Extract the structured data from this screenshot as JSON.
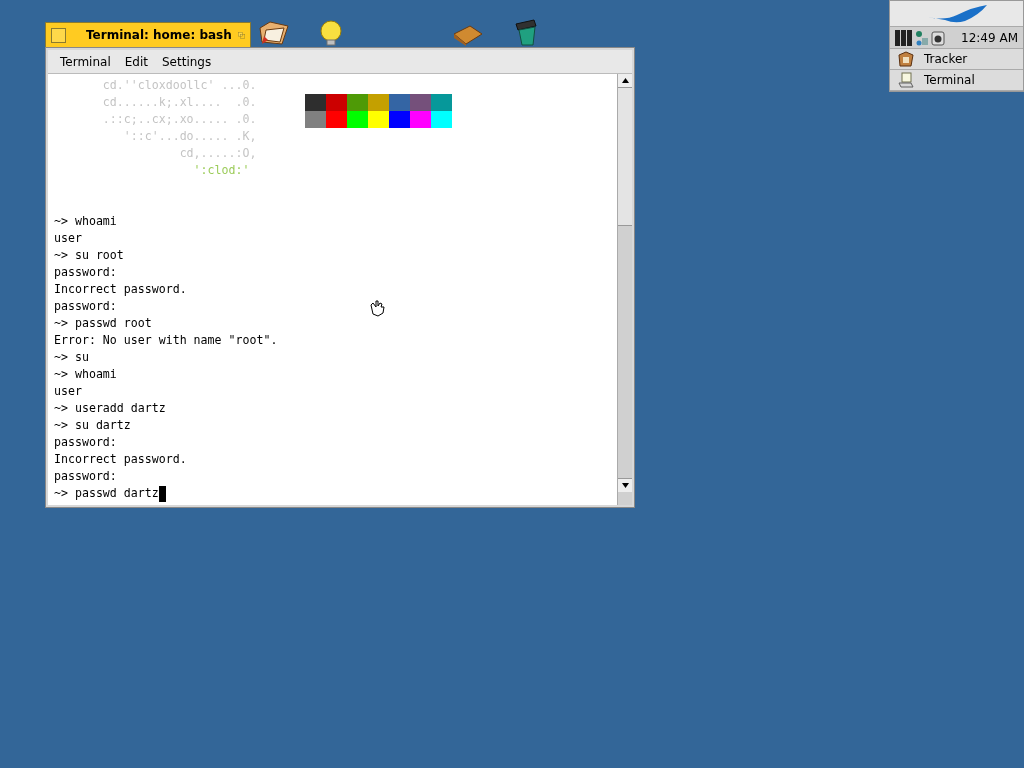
{
  "window": {
    "title": "Terminal: home: bash",
    "focused": true,
    "menu": [
      "Terminal",
      "Edit",
      "Settings"
    ]
  },
  "terminal": {
    "logo_lines": [
      {
        "text": "       cd.''cloxdoollc' ...0.",
        "color": "#c4c4c4"
      },
      {
        "text": "       cd......k;.xl....  .0.",
        "color": "#c4c4c4"
      },
      {
        "text": "       .::c;..cx;.xo..... .0.",
        "color": "#c4c4c4"
      },
      {
        "text": "          '::c'...do..... .K,",
        "color": "#c4c4c4"
      },
      {
        "text": "                  cd,.....:O,",
        "color": "#c4c4c4"
      },
      {
        "text": "                    ':clod:'",
        "color": "#9ccc5a"
      }
    ],
    "palette": [
      {
        "color": "#2e2e2e"
      },
      {
        "color": "#cc0000"
      },
      {
        "color": "#4e9a06"
      },
      {
        "color": "#c4a000"
      },
      {
        "color": "#3465a4"
      },
      {
        "color": "#75507b"
      },
      {
        "color": "#06989a"
      },
      {
        "color": "#808080"
      },
      {
        "color": "#ff0000"
      },
      {
        "color": "#00ff00"
      },
      {
        "color": "#ffff00"
      },
      {
        "color": "#0000ff"
      },
      {
        "color": "#ff00ff"
      },
      {
        "color": "#00ffff"
      }
    ],
    "lines": [
      "~> whoami",
      "user",
      "~> su root",
      "password:",
      "Incorrect password.",
      "password:",
      "~> passwd root",
      "Error: No user with name \"root\".",
      "~> su",
      "~> whoami",
      "user",
      "~> useradd dartz",
      "~> su dartz",
      "password:",
      "Incorrect password.",
      "password:",
      "~> passwd dartz"
    ],
    "cursor_visible": true
  },
  "desktop_icons": [
    {
      "kind": "folder"
    },
    {
      "kind": "bulb"
    },
    {
      "kind": "package"
    },
    {
      "kind": "trash"
    }
  ],
  "deskbar": {
    "clock": "12:49 AM",
    "apps": [
      {
        "name": "Tracker",
        "kind": "tracker"
      },
      {
        "name": "Terminal",
        "kind": "terminal"
      }
    ]
  }
}
